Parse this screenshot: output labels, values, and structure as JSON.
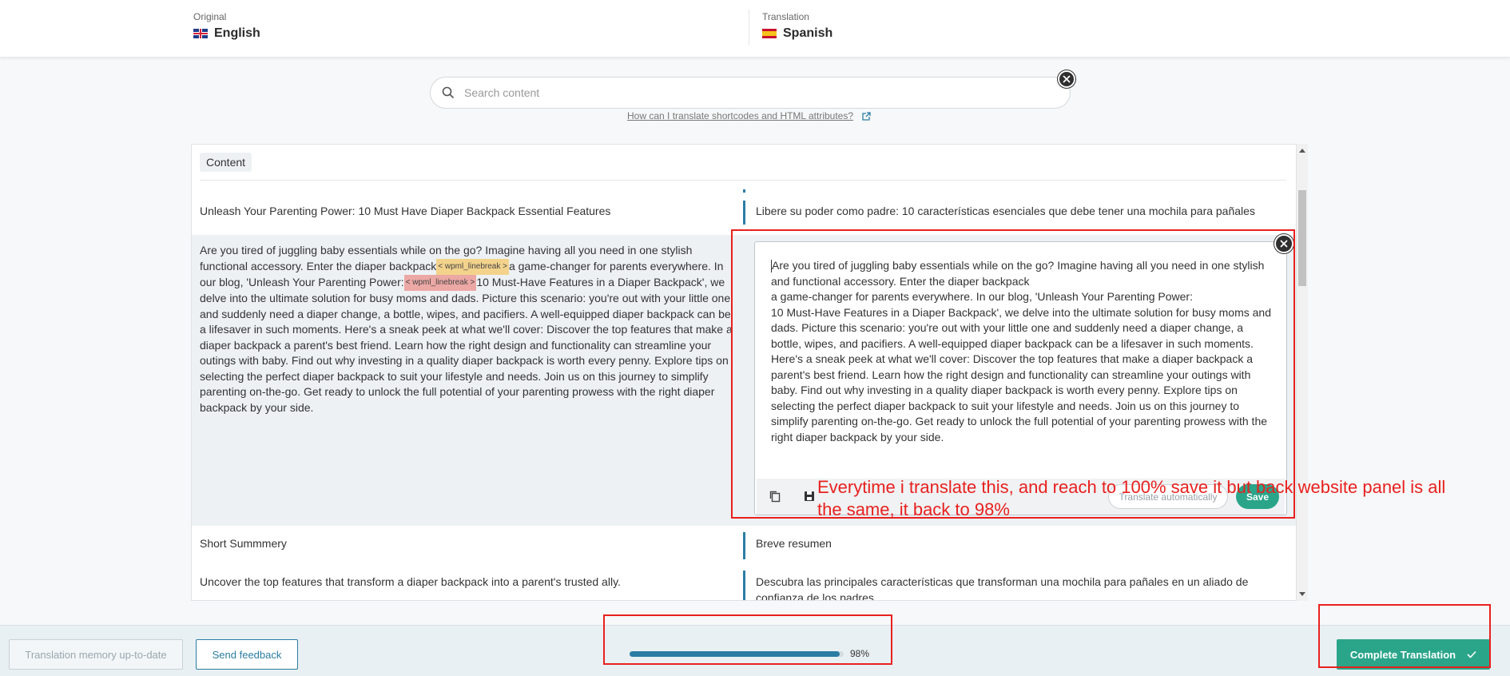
{
  "header": {
    "original_caption": "Original",
    "original_language": "English",
    "translation_caption": "Translation",
    "translation_language": "Spanish"
  },
  "search": {
    "placeholder": "Search content",
    "help_link": "How can I translate shortcodes and HTML attributes?"
  },
  "panel": {
    "section_tag": "Content",
    "rows": [
      {
        "source": "Unleash Your Parenting Power: 10 Must Have Diaper Backpack Essential Features",
        "target": "Libere su poder como padre: 10 características esenciales que debe tener una mochila para pañales"
      },
      {
        "source_part1": "Are you tired of juggling baby essentials while on the go? Imagine having all you need in one stylish functional accessory. Enter the diaper backpack",
        "tag1": "< wpml_linebreak >",
        "source_part2": "a game-changer for parents everywhere. In our blog, 'Unleash Your Parenting Power:",
        "tag2": "< wpml_linebreak >",
        "source_part3": "10 Must-Have Features in a Diaper Backpack', we delve into the ultimate solution for busy moms and dads. Picture this scenario: you're out with your little one and suddenly need a diaper change, a bottle, wipes, and pacifiers. A well-equipped diaper backpack can be a lifesaver in such moments. Here's a sneak peek at what we'll cover: Discover the top features that make a diaper backpack a parent's best friend. Learn how the right design and functionality can streamline your outings with baby. Find out why investing in a quality diaper backpack is worth every penny. Explore tips on selecting the perfect diaper backpack to suit your lifestyle and needs. Join us on this journey to simplify parenting on-the-go. Get ready to unlock the full potential of your parenting prowess with the right diaper backpack by your side.",
        "editor_line1": "Are you tired of juggling baby essentials while on the go? Imagine having all you need in one stylish and functional accessory. Enter the diaper backpack",
        "editor_line2": "a game-changer for parents everywhere. In our blog, 'Unleash Your Parenting Power:",
        "editor_line3": "10 Must-Have Features in a Diaper Backpack', we delve into the ultimate solution for busy moms and dads. Picture this scenario: you're out with your little one and suddenly need a diaper change, a bottle, wipes, and pacifiers. A well-equipped diaper backpack can be a lifesaver in such moments. Here's a sneak peek at what we'll cover: Discover the top features that make a diaper backpack a parent's best friend. Learn how the right design and functionality can streamline your outings with baby. Find out why investing in a quality diaper backpack is worth every penny. Explore tips on selecting the perfect diaper backpack to suit your lifestyle and needs. Join us on this journey to simplify parenting on-the-go. Get ready to unlock the full potential of your parenting prowess with the right diaper backpack by your side."
      },
      {
        "source": "Short Summmery",
        "target": "Breve resumen"
      },
      {
        "source": "Uncover the top features that transform a diaper backpack into a parent's trusted ally.",
        "target": "Descubra las principales características que transforman una mochila para pañales en un aliado de confianza de los padres."
      }
    ]
  },
  "editor": {
    "auto_translate_label": "Translate automatically",
    "save_label": "Save"
  },
  "footer": {
    "tm_label": "Translation memory up-to-date",
    "feedback_label": "Send feedback",
    "progress_value": 98,
    "progress_label": "98%",
    "complete_label": "Complete Translation"
  },
  "annotation": {
    "text": "Everytime i translate this, and reach to 100% save it but back website panel is all the same, it back to 98%",
    "color": "#e8211f"
  },
  "colors": {
    "accent_blue": "#2b7da4",
    "accent_green": "#2aa58a",
    "annotation_red": "#e8211f"
  }
}
